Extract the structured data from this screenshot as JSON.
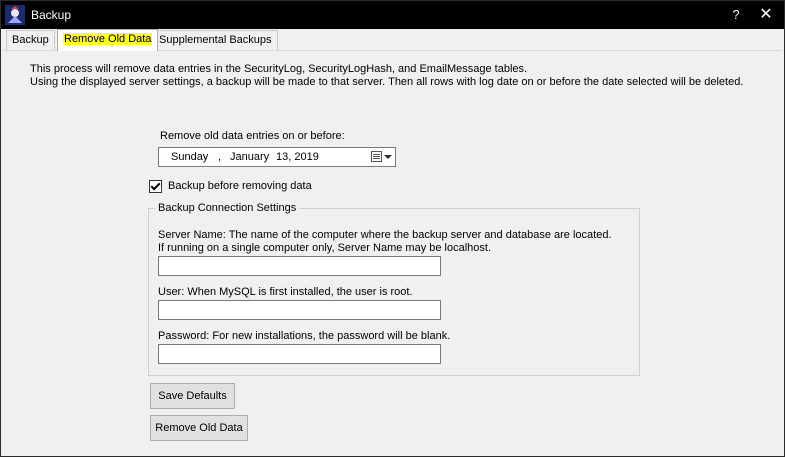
{
  "window": {
    "title": "Backup",
    "help_glyph": "?",
    "close_glyph": "✕"
  },
  "tabs": [
    {
      "label": "Backup"
    },
    {
      "label": "Remove Old Data"
    },
    {
      "label": "Supplemental Backups"
    }
  ],
  "info": {
    "line1": "This process will remove data entries in the SecurityLog, SecurityLogHash, and EmailMessage tables.",
    "line2": "Using the displayed server settings, a backup will be made to that server. Then all rows with log date on or before the date selected will be deleted."
  },
  "date_picker": {
    "label": "Remove old data entries on or before:",
    "day": "Sunday",
    "separator": ",",
    "month": "January",
    "date": "13, 2019"
  },
  "backup_checkbox": {
    "label": "Backup before removing data",
    "checked": true
  },
  "connection": {
    "title": "Backup Connection Settings",
    "server_desc1": "Server Name: The name of the computer where the backup server and database are located.",
    "server_desc2": "If running on a single computer only, Server Name may be localhost.",
    "server_value": "",
    "user_desc": "User: When MySQL is first installed, the user is root.",
    "user_value": "",
    "password_desc": "Password: For new installations, the password will be blank.",
    "password_value": ""
  },
  "buttons": {
    "save_defaults": "Save Defaults",
    "remove_old_data": "Remove Old Data"
  },
  "colors": {
    "titlebar": "#000000",
    "tab_highlight": "#ffff33",
    "panel": "#f0f0f0"
  }
}
